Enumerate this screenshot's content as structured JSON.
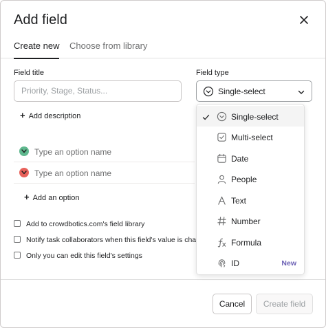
{
  "dialog": {
    "title": "Add field",
    "close_icon": "close-icon"
  },
  "tabs": [
    {
      "label": "Create new",
      "active": true
    },
    {
      "label": "Choose from library",
      "active": false
    }
  ],
  "form": {
    "field_title_label": "Field title",
    "field_title_placeholder": "Priority, Stage, Status...",
    "field_type_label": "Field type",
    "field_type_value": "Single-select",
    "add_description": "Add description",
    "options": [
      {
        "placeholder": "Type an option name",
        "color": "#5fb88e",
        "icon": "chevron-down-icon"
      },
      {
        "placeholder": "Type an option name",
        "color": "#e8615a",
        "icon": "chevron-down-icon"
      }
    ],
    "add_option": "Add an option",
    "checkboxes": [
      {
        "label": "Add to crowdbotics.com's field library",
        "checked": false
      },
      {
        "label": "Notify task collaborators when this field's value is chang",
        "checked": false
      },
      {
        "label": "Only you can edit this field's settings",
        "checked": false
      }
    ]
  },
  "footer": {
    "cancel_label": "Cancel",
    "create_label": "Create field"
  },
  "field_type_menu": {
    "items": [
      {
        "label": "Single-select",
        "icon": "single-select-icon",
        "selected": true,
        "badge": ""
      },
      {
        "label": "Multi-select",
        "icon": "multi-select-icon",
        "selected": false,
        "badge": ""
      },
      {
        "label": "Date",
        "icon": "calendar-icon",
        "selected": false,
        "badge": ""
      },
      {
        "label": "People",
        "icon": "person-icon",
        "selected": false,
        "badge": ""
      },
      {
        "label": "Text",
        "icon": "text-icon",
        "selected": false,
        "badge": ""
      },
      {
        "label": "Number",
        "icon": "hash-icon",
        "selected": false,
        "badge": ""
      },
      {
        "label": "Formula",
        "icon": "formula-icon",
        "selected": false,
        "badge": ""
      },
      {
        "label": "ID",
        "icon": "fingerprint-icon",
        "selected": false,
        "badge": "New"
      }
    ]
  },
  "colors": {
    "accent": "#6a5fb4",
    "option_green": "#5fb88e",
    "option_red": "#e8615a"
  }
}
